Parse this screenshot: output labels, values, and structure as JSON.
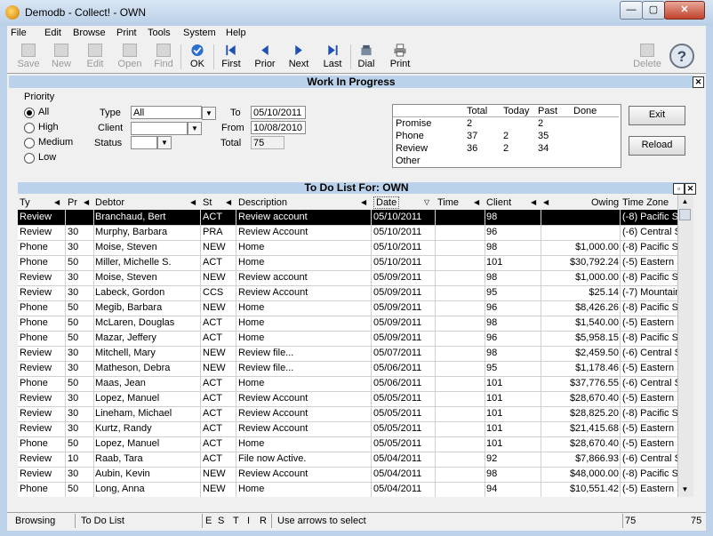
{
  "window": {
    "title": "Demodb - Collect! - OWN",
    "minimize_glyph": "—",
    "maximize_glyph": "▢",
    "close_glyph": "✕"
  },
  "menu": [
    "File",
    "Edit",
    "Browse",
    "Print",
    "Tools",
    "System",
    "Help"
  ],
  "toolbar": [
    {
      "label": "Save",
      "enabled": false,
      "icon": "save-icon"
    },
    {
      "label": "New",
      "enabled": false,
      "icon": "new-icon"
    },
    {
      "label": "Edit",
      "enabled": false,
      "icon": "edit-icon"
    },
    {
      "label": "Open",
      "enabled": false,
      "icon": "open-icon"
    },
    {
      "label": "Find",
      "enabled": false,
      "icon": "find-icon"
    },
    {
      "label": "OK",
      "enabled": true,
      "icon": "ok-check-icon"
    },
    {
      "label": "First",
      "enabled": true,
      "icon": "first-icon"
    },
    {
      "label": "Prior",
      "enabled": true,
      "icon": "prior-icon"
    },
    {
      "label": "Next",
      "enabled": true,
      "icon": "next-icon"
    },
    {
      "label": "Last",
      "enabled": true,
      "icon": "last-icon"
    },
    {
      "label": "Dial",
      "enabled": true,
      "icon": "phone-icon"
    },
    {
      "label": "Print",
      "enabled": true,
      "icon": "printer-icon"
    },
    {
      "label": "Delete",
      "enabled": false,
      "icon": "delete-icon"
    }
  ],
  "wip": {
    "title": "Work In Progress",
    "priority_label": "Priority",
    "priorities": [
      {
        "label": "All",
        "checked": true
      },
      {
        "label": "High",
        "checked": false
      },
      {
        "label": "Medium",
        "checked": false
      },
      {
        "label": "Low",
        "checked": false
      }
    ],
    "type_label": "Type",
    "type_value": "All",
    "client_label": "Client",
    "client_value": "",
    "status_label": "Status",
    "status_value": "",
    "to_label": "To",
    "to_value": "05/10/2011",
    "from_label": "From",
    "from_value": "10/08/2010",
    "total_label": "Total",
    "total_value": "75",
    "summary_headers": [
      "Total",
      "Today",
      "Past",
      "Done"
    ],
    "summary_rows": [
      {
        "name": "Promise",
        "total": "2",
        "today": "",
        "past": "2",
        "done": ""
      },
      {
        "name": "Phone",
        "total": "37",
        "today": "2",
        "past": "35",
        "done": ""
      },
      {
        "name": "Review",
        "total": "36",
        "today": "2",
        "past": "34",
        "done": ""
      },
      {
        "name": "Other",
        "total": "",
        "today": "",
        "past": "",
        "done": ""
      }
    ],
    "exit_label": "Exit",
    "reload_label": "Reload"
  },
  "todo": {
    "title": "To Do List For:  OWN",
    "columns": [
      "Ty",
      "Pr",
      "Debtor",
      "St",
      "Description",
      "Date",
      "Time",
      "Client",
      "",
      "Owing",
      "Time Zone"
    ],
    "rows": [
      [
        "Review",
        "",
        "Branchaud, Bert",
        "ACT",
        "Review account",
        "05/10/2011",
        "",
        "98",
        "",
        "",
        "(-8) Pacific S"
      ],
      [
        "Review",
        "30",
        "Murphy, Barbara",
        "PRA",
        "Review Account",
        "05/10/2011",
        "",
        "96",
        "",
        "",
        "(-6) Central S"
      ],
      [
        "Phone",
        "30",
        "Moise, Steven",
        "NEW",
        "Home",
        "05/10/2011",
        "",
        "98",
        "",
        "$1,000.00",
        "(-8) Pacific S"
      ],
      [
        "Phone",
        "50",
        "Miller, Michelle S.",
        "ACT",
        "Home",
        "05/10/2011",
        "",
        "101",
        "",
        "$30,792.24",
        "(-5) Eastern S"
      ],
      [
        "Review",
        "30",
        "Moise, Steven",
        "NEW",
        "Review account",
        "05/09/2011",
        "",
        "98",
        "",
        "$1,000.00",
        "(-8) Pacific S"
      ],
      [
        "Review",
        "30",
        "Labeck, Gordon",
        "CCS",
        "Review Account",
        "05/09/2011",
        "",
        "95",
        "",
        "$25.14",
        "(-7) Mountain"
      ],
      [
        "Phone",
        "50",
        "Megib, Barbara",
        "NEW",
        "Home",
        "05/09/2011",
        "",
        "96",
        "",
        "$8,426.26",
        "(-8) Pacific S"
      ],
      [
        "Phone",
        "50",
        "McLaren, Douglas",
        "ACT",
        "Home",
        "05/09/2011",
        "",
        "98",
        "",
        "$1,540.00",
        "(-5) Eastern S"
      ],
      [
        "Phone",
        "50",
        "Mazar, Jeffery",
        "ACT",
        "Home",
        "05/09/2011",
        "",
        "96",
        "",
        "$5,958.15",
        "(-8) Pacific S"
      ],
      [
        "Review",
        "30",
        "Mitchell, Mary",
        "NEW",
        "Review file...",
        "05/07/2011",
        "",
        "98",
        "",
        "$2,459.50",
        "(-6) Central S"
      ],
      [
        "Review",
        "30",
        "Matheson, Debra",
        "NEW",
        "Review file...",
        "05/06/2011",
        "",
        "95",
        "",
        "$1,178.46",
        "(-5) Eastern S"
      ],
      [
        "Phone",
        "50",
        "Maas, Jean",
        "ACT",
        "Home",
        "05/06/2011",
        "",
        "101",
        "",
        "$37,776.55",
        "(-6) Central S"
      ],
      [
        "Review",
        "30",
        "Lopez, Manuel",
        "ACT",
        "Review Account",
        "05/05/2011",
        "",
        "101",
        "",
        "$28,670.40",
        "(-5) Eastern S"
      ],
      [
        "Review",
        "30",
        "Lineham, Michael",
        "ACT",
        "Review Account",
        "05/05/2011",
        "",
        "101",
        "",
        "$28,825.20",
        "(-8) Pacific S"
      ],
      [
        "Review",
        "30",
        "Kurtz, Randy",
        "ACT",
        "Review Account",
        "05/05/2011",
        "",
        "101",
        "",
        "$21,415.68",
        "(-5) Eastern S"
      ],
      [
        "Phone",
        "50",
        "Lopez, Manuel",
        "ACT",
        "Home",
        "05/05/2011",
        "",
        "101",
        "",
        "$28,670.40",
        "(-5) Eastern S"
      ],
      [
        "Review",
        "10",
        "Raab, Tara",
        "ACT",
        "File now Active.",
        "05/04/2011",
        "",
        "92",
        "",
        "$7,866.93",
        "(-6) Central S"
      ],
      [
        "Review",
        "30",
        "Aubin, Kevin",
        "NEW",
        "Review Account",
        "05/04/2011",
        "",
        "98",
        "",
        "$48,000.00",
        "(-8) Pacific S"
      ],
      [
        "Phone",
        "50",
        "Long, Anna",
        "NEW",
        "Home",
        "05/04/2011",
        "",
        "94",
        "",
        "$10,551.42",
        "(-5) Eastern S"
      ]
    ]
  },
  "status": {
    "mode": "Browsing",
    "view": "To Do List",
    "flags": [
      "E",
      "S",
      "T",
      "I",
      "R"
    ],
    "hint": "Use arrows to select",
    "count1": "75",
    "count2": "75"
  }
}
